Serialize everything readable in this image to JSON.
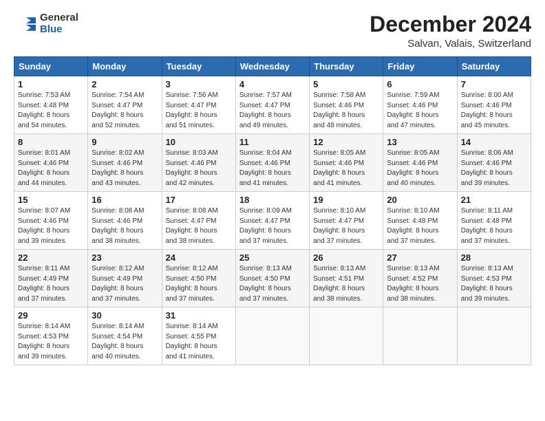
{
  "logo": {
    "general": "General",
    "blue": "Blue"
  },
  "title": "December 2024",
  "subtitle": "Salvan, Valais, Switzerland",
  "header": {
    "days": [
      "Sunday",
      "Monday",
      "Tuesday",
      "Wednesday",
      "Thursday",
      "Friday",
      "Saturday"
    ]
  },
  "weeks": [
    [
      {
        "day": "1",
        "sunrise": "7:53 AM",
        "sunset": "4:48 PM",
        "daylight": "8 hours and 54 minutes."
      },
      {
        "day": "2",
        "sunrise": "7:54 AM",
        "sunset": "4:47 PM",
        "daylight": "8 hours and 52 minutes."
      },
      {
        "day": "3",
        "sunrise": "7:56 AM",
        "sunset": "4:47 PM",
        "daylight": "8 hours and 51 minutes."
      },
      {
        "day": "4",
        "sunrise": "7:57 AM",
        "sunset": "4:47 PM",
        "daylight": "8 hours and 49 minutes."
      },
      {
        "day": "5",
        "sunrise": "7:58 AM",
        "sunset": "4:46 PM",
        "daylight": "8 hours and 48 minutes."
      },
      {
        "day": "6",
        "sunrise": "7:59 AM",
        "sunset": "4:46 PM",
        "daylight": "8 hours and 47 minutes."
      },
      {
        "day": "7",
        "sunrise": "8:00 AM",
        "sunset": "4:46 PM",
        "daylight": "8 hours and 45 minutes."
      }
    ],
    [
      {
        "day": "8",
        "sunrise": "8:01 AM",
        "sunset": "4:46 PM",
        "daylight": "8 hours and 44 minutes."
      },
      {
        "day": "9",
        "sunrise": "8:02 AM",
        "sunset": "4:46 PM",
        "daylight": "8 hours and 43 minutes."
      },
      {
        "day": "10",
        "sunrise": "8:03 AM",
        "sunset": "4:46 PM",
        "daylight": "8 hours and 42 minutes."
      },
      {
        "day": "11",
        "sunrise": "8:04 AM",
        "sunset": "4:46 PM",
        "daylight": "8 hours and 41 minutes."
      },
      {
        "day": "12",
        "sunrise": "8:05 AM",
        "sunset": "4:46 PM",
        "daylight": "8 hours and 41 minutes."
      },
      {
        "day": "13",
        "sunrise": "8:05 AM",
        "sunset": "4:46 PM",
        "daylight": "8 hours and 40 minutes."
      },
      {
        "day": "14",
        "sunrise": "8:06 AM",
        "sunset": "4:46 PM",
        "daylight": "8 hours and 39 minutes."
      }
    ],
    [
      {
        "day": "15",
        "sunrise": "8:07 AM",
        "sunset": "4:46 PM",
        "daylight": "8 hours and 39 minutes."
      },
      {
        "day": "16",
        "sunrise": "8:08 AM",
        "sunset": "4:46 PM",
        "daylight": "8 hours and 38 minutes."
      },
      {
        "day": "17",
        "sunrise": "8:08 AM",
        "sunset": "4:47 PM",
        "daylight": "8 hours and 38 minutes."
      },
      {
        "day": "18",
        "sunrise": "8:09 AM",
        "sunset": "4:47 PM",
        "daylight": "8 hours and 37 minutes."
      },
      {
        "day": "19",
        "sunrise": "8:10 AM",
        "sunset": "4:47 PM",
        "daylight": "8 hours and 37 minutes."
      },
      {
        "day": "20",
        "sunrise": "8:10 AM",
        "sunset": "4:48 PM",
        "daylight": "8 hours and 37 minutes."
      },
      {
        "day": "21",
        "sunrise": "8:11 AM",
        "sunset": "4:48 PM",
        "daylight": "8 hours and 37 minutes."
      }
    ],
    [
      {
        "day": "22",
        "sunrise": "8:11 AM",
        "sunset": "4:49 PM",
        "daylight": "8 hours and 37 minutes."
      },
      {
        "day": "23",
        "sunrise": "8:12 AM",
        "sunset": "4:49 PM",
        "daylight": "8 hours and 37 minutes."
      },
      {
        "day": "24",
        "sunrise": "8:12 AM",
        "sunset": "4:50 PM",
        "daylight": "8 hours and 37 minutes."
      },
      {
        "day": "25",
        "sunrise": "8:13 AM",
        "sunset": "4:50 PM",
        "daylight": "8 hours and 37 minutes."
      },
      {
        "day": "26",
        "sunrise": "8:13 AM",
        "sunset": "4:51 PM",
        "daylight": "8 hours and 38 minutes."
      },
      {
        "day": "27",
        "sunrise": "8:13 AM",
        "sunset": "4:52 PM",
        "daylight": "8 hours and 38 minutes."
      },
      {
        "day": "28",
        "sunrise": "8:13 AM",
        "sunset": "4:53 PM",
        "daylight": "8 hours and 39 minutes."
      }
    ],
    [
      {
        "day": "29",
        "sunrise": "8:14 AM",
        "sunset": "4:53 PM",
        "daylight": "8 hours and 39 minutes."
      },
      {
        "day": "30",
        "sunrise": "8:14 AM",
        "sunset": "4:54 PM",
        "daylight": "8 hours and 40 minutes."
      },
      {
        "day": "31",
        "sunrise": "8:14 AM",
        "sunset": "4:55 PM",
        "daylight": "8 hours and 41 minutes."
      },
      null,
      null,
      null,
      null
    ]
  ]
}
